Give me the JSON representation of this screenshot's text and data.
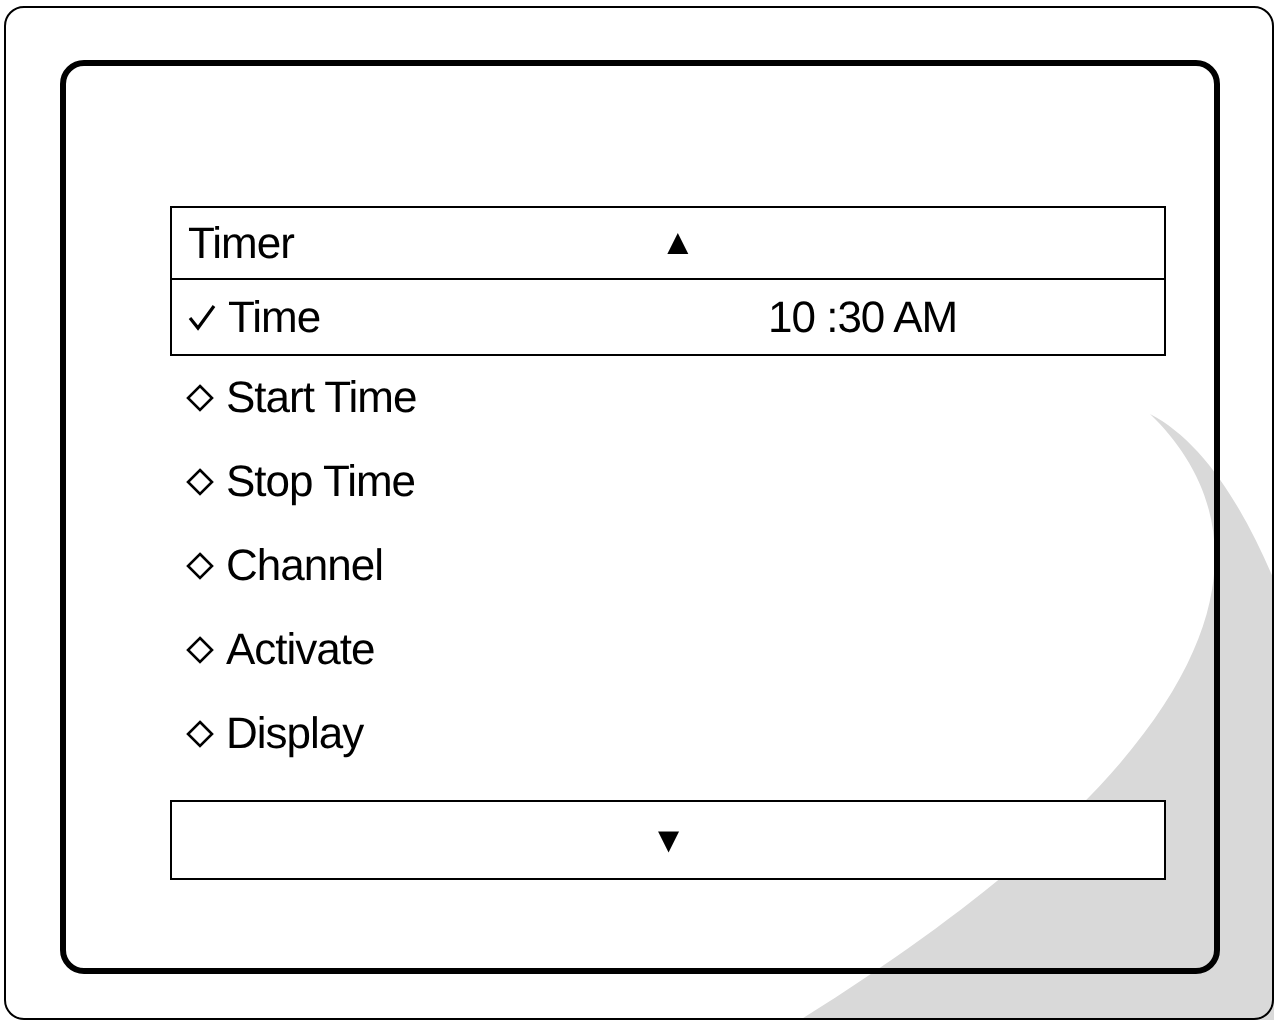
{
  "menu": {
    "title": "Timer",
    "up_arrow": "▲",
    "down_arrow": "▼",
    "items": [
      {
        "label": "Time",
        "value": "10 :30 AM",
        "selected": true
      },
      {
        "label": "Start Time",
        "selected": false
      },
      {
        "label": "Stop Time",
        "selected": false
      },
      {
        "label": "Channel",
        "selected": false
      },
      {
        "label": "Activate",
        "selected": false
      },
      {
        "label": "Display",
        "selected": false
      }
    ]
  }
}
